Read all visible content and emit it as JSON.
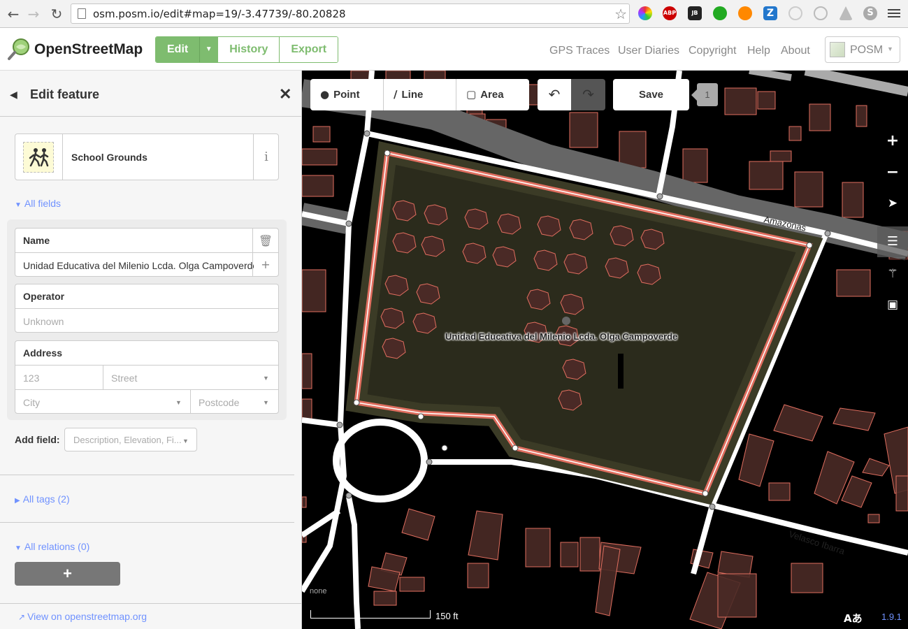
{
  "browser": {
    "url": "osm.posm.io/edit#map=19/-3.47739/-80.20828",
    "extensions": [
      {
        "name": "color-wheel-icon",
        "color": "#e44"
      },
      {
        "name": "adblock-icon",
        "label": "ABP",
        "color": "#c00"
      },
      {
        "name": "jetbrains-icon",
        "label": "JB",
        "color": "#222"
      },
      {
        "name": "hangouts-icon",
        "color": "#2a2"
      },
      {
        "name": "orange-ext-icon",
        "color": "#f80"
      },
      {
        "name": "z-ext-icon",
        "label": "Z",
        "color": "#27c"
      },
      {
        "name": "feather-ext-icon",
        "color": "#bbb"
      },
      {
        "name": "target-ext-icon",
        "color": "#bbb"
      },
      {
        "name": "angular-ext-icon",
        "color": "#aaa"
      },
      {
        "name": "s-ext-icon",
        "color": "#aaa"
      }
    ]
  },
  "header": {
    "logo_text": "OpenStreetMap",
    "edit": "Edit",
    "history": "History",
    "export": "Export",
    "nav": [
      "GPS Traces",
      "User Diaries",
      "Copyright",
      "Help",
      "About"
    ],
    "user": "POSM"
  },
  "sidebar": {
    "title": "Edit feature",
    "preset_name": "School Grounds",
    "info_glyph": "i",
    "all_fields": "All fields",
    "name_label": "Name",
    "name_value": "Unidad Educativa del Milenio Lcda. Olga Campoverde",
    "operator_label": "Operator",
    "operator_placeholder": "Unknown",
    "address_label": "Address",
    "housenumber_placeholder": "123",
    "street_placeholder": "Street",
    "city_placeholder": "City",
    "postcode_placeholder": "Postcode",
    "add_field_label": "Add field:",
    "add_field_placeholder": "Description, Elevation, Fi...",
    "all_tags": "All tags (2)",
    "all_relations": "All relations (0)",
    "add_relation": "+",
    "view_link": "View on openstreetmap.org"
  },
  "map": {
    "tools": {
      "point": "Point",
      "line": "Line",
      "area": "Area"
    },
    "save": "Save",
    "save_count": "1",
    "feature_label": "Unidad Educativa del Milenio Lcda. Olga Campoverde",
    "street_amazonas": "Amazonas",
    "street_velasco": "Velasco Ibarra",
    "scale": "150 ft",
    "imagery": "none",
    "version": "1.9.1",
    "i18n": "Aあ",
    "colors": {
      "selected": "#e06e5f",
      "building_fill": "#4a2a26",
      "building_stroke": "#e06e5f",
      "road": "#ffffff",
      "school_fill": "#2b2b1c"
    }
  }
}
